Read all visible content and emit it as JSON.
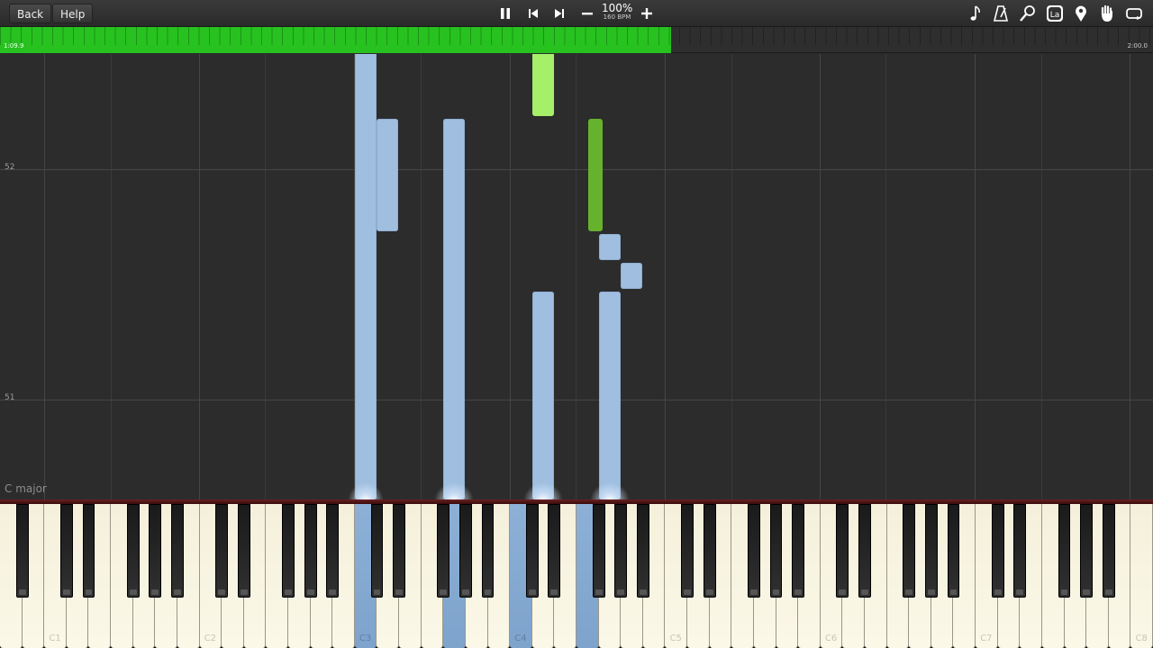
{
  "toolbar": {
    "back_label": "Back",
    "help_label": "Help",
    "speed_percent": "100%",
    "tempo": "160 BPM",
    "controls": [
      "pause-icon",
      "previous-icon",
      "next-icon",
      "minus-icon",
      "plus-icon"
    ],
    "tools": [
      "note-icon",
      "metronome-icon",
      "zoom-icon",
      "label-icon",
      "marker-icon",
      "hand-icon",
      "loop-icon"
    ]
  },
  "progress": {
    "current_time": "1:09.9",
    "total_time": "2:00.0",
    "fraction": 0.582,
    "color": "#27c21f"
  },
  "notes_view": {
    "measure_numbers": [
      "52",
      "51"
    ],
    "key_signature": "C major",
    "colors": {
      "right_hand_lime": "#a6ef69",
      "right_hand_green": "#67b22d",
      "left_hand_blue": "#a0bfe0"
    }
  },
  "keyboard": {
    "first_key": "A0",
    "white_key_count": 52,
    "octave_labels": [
      "C1",
      "C2",
      "C3",
      "C4",
      "C5",
      "C6",
      "C7",
      "C8"
    ],
    "active_keys": [
      "C3",
      "G3",
      "C4",
      "F4"
    ]
  }
}
